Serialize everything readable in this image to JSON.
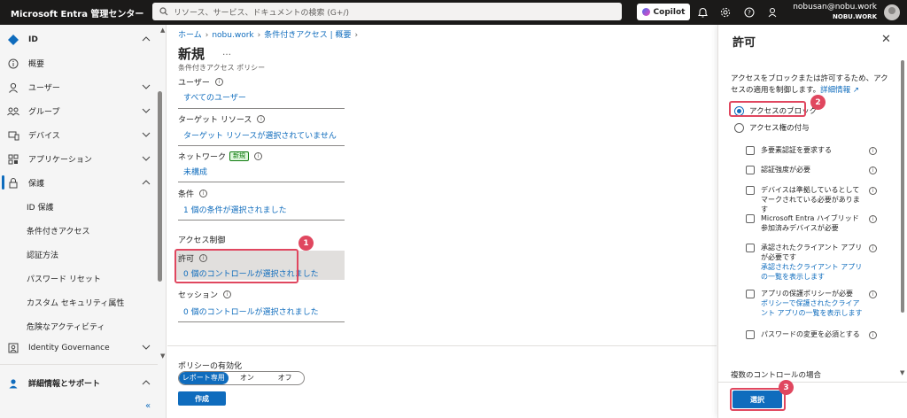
{
  "topbar": {
    "app_title": "Microsoft Entra 管理センター",
    "search_placeholder": "リソース、サービス、ドキュメントの検索 (G+/)",
    "copilot_label": "Copilot",
    "user_email": "nobusan@nobu.work",
    "user_tenant": "NOBU.WORK"
  },
  "sidebar": {
    "items": [
      {
        "label": "ID"
      },
      {
        "label": "概要"
      },
      {
        "label": "ユーザー"
      },
      {
        "label": "グループ"
      },
      {
        "label": "デバイス"
      },
      {
        "label": "アプリケーション"
      },
      {
        "label": "保護"
      },
      {
        "label": "ID 保護"
      },
      {
        "label": "条件付きアクセス"
      },
      {
        "label": "認証方法"
      },
      {
        "label": "パスワード リセット"
      },
      {
        "label": "カスタム セキュリティ属性"
      },
      {
        "label": "危険なアクティビティ"
      },
      {
        "label": "Identity Governance"
      },
      {
        "label": "詳細情報とサポート"
      }
    ],
    "collapse_label": "«"
  },
  "main": {
    "breadcrumb": [
      "ホーム",
      "nobu.work",
      "条件付きアクセス | 概要"
    ],
    "title": "新規",
    "ellipsis": "…",
    "subtitle": "条件付きアクセス ポリシー",
    "sections": {
      "users_label": "ユーザー",
      "users_value": "すべてのユーザー",
      "target_label": "ターゲット リソース",
      "target_value": "ターゲット リソースが選択されていません",
      "network_label": "ネットワーク",
      "network_badge": "新規",
      "network_value": "未構成",
      "conditions_label": "条件",
      "conditions_value": "1 個の条件が選択されました",
      "access_controls_heading": "アクセス制御",
      "grant_label": "許可",
      "grant_value": "0 個のコントロールが選択されました",
      "session_label": "セッション",
      "session_value": "0 個のコントロールが選択されました"
    },
    "enable_policy_label": "ポリシーの有効化",
    "toggle_options": [
      "レポート専用",
      "オン",
      "オフ"
    ],
    "toggle_selected": "レポート専用",
    "create_button": "作成"
  },
  "panel": {
    "title": "許可",
    "close": "✕",
    "description": "アクセスをブロックまたは許可するため、アクセスの適用を制御します。",
    "learn_more": "詳細情報",
    "radios": [
      {
        "label": "アクセスのブロック",
        "selected": true
      },
      {
        "label": "アクセス権の付与",
        "selected": false
      }
    ],
    "checkboxes": [
      {
        "label": "多要素認証を要求する",
        "link": ""
      },
      {
        "label": "認証強度が必要",
        "link": ""
      },
      {
        "label": "デバイスは準拠しているとしてマークされている必要があります",
        "link": ""
      },
      {
        "label": "Microsoft Entra ハイブリッド参加済みデバイスが必要",
        "link": ""
      },
      {
        "label": "承認されたクライアント アプリが必要です",
        "link": "承認されたクライアント アプリの一覧を表示します"
      },
      {
        "label": "アプリの保護ポリシーが必要",
        "link": "ポリシーで保護されたクライアント アプリの一覧を表示します"
      },
      {
        "label": "パスワードの変更を必須とする",
        "link": ""
      }
    ],
    "multi_controls_label": "複数のコントロールの場合",
    "select_button": "選択"
  },
  "callouts": [
    "1",
    "2",
    "3"
  ],
  "colors": {
    "accent": "#0f6cbd",
    "callout": "#e0475f",
    "topbar": "#1b1a19"
  }
}
